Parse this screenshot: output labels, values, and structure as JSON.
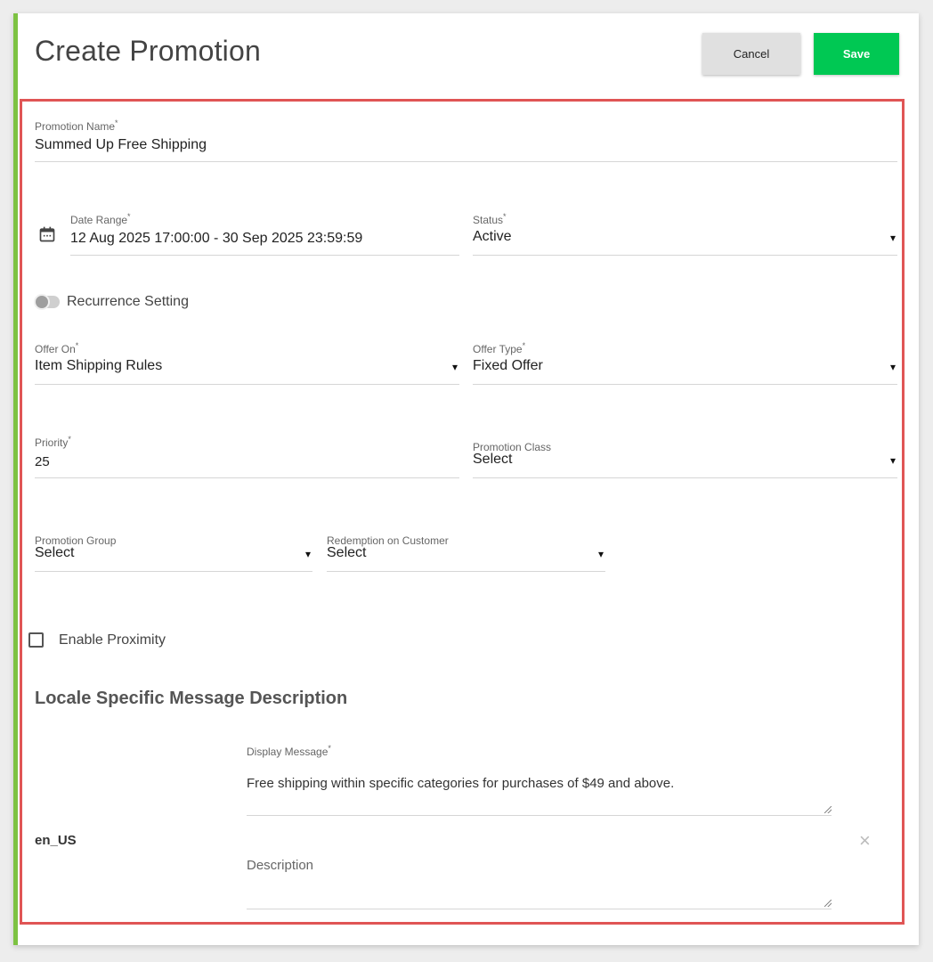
{
  "header": {
    "title": "Create Promotion",
    "cancel_label": "Cancel",
    "save_label": "Save"
  },
  "form": {
    "promotion_name": {
      "label": "Promotion Name",
      "required": "*",
      "value": "Summed Up Free Shipping"
    },
    "date_range": {
      "label": "Date Range",
      "required": "*",
      "value": "12 Aug 2025 17:00:00 - 30 Sep 2025 23:59:59"
    },
    "status": {
      "label": "Status",
      "required": "*",
      "value": "Active"
    },
    "recurrence": {
      "label": "Recurrence Setting",
      "enabled": false
    },
    "offer_on": {
      "label": "Offer On",
      "required": "*",
      "value": "Item Shipping Rules"
    },
    "offer_type": {
      "label": "Offer Type",
      "required": "*",
      "value": "Fixed Offer"
    },
    "priority": {
      "label": "Priority",
      "required": "*",
      "value": "25"
    },
    "promotion_class": {
      "label": "Promotion Class",
      "value": "Select"
    },
    "promotion_group": {
      "label": "Promotion Group",
      "value": "Select"
    },
    "redemption_on_customer": {
      "label": "Redemption on Customer",
      "value": "Select"
    },
    "enable_proximity": {
      "label": "Enable Proximity",
      "checked": false
    }
  },
  "locale_section": {
    "title": "Locale Specific Message Description",
    "locale": "en_US",
    "display_message": {
      "label": "Display Message",
      "required": "*",
      "value": "Free shipping within specific categories for purchases of $49 and above."
    },
    "description": {
      "placeholder": "Description"
    }
  },
  "icons": {
    "calendar": "calendar-icon",
    "dropdown": "▾",
    "close": "×"
  },
  "colors": {
    "accent": "#7dc242",
    "save": "#00c853",
    "highlight_border": "#e05555"
  }
}
